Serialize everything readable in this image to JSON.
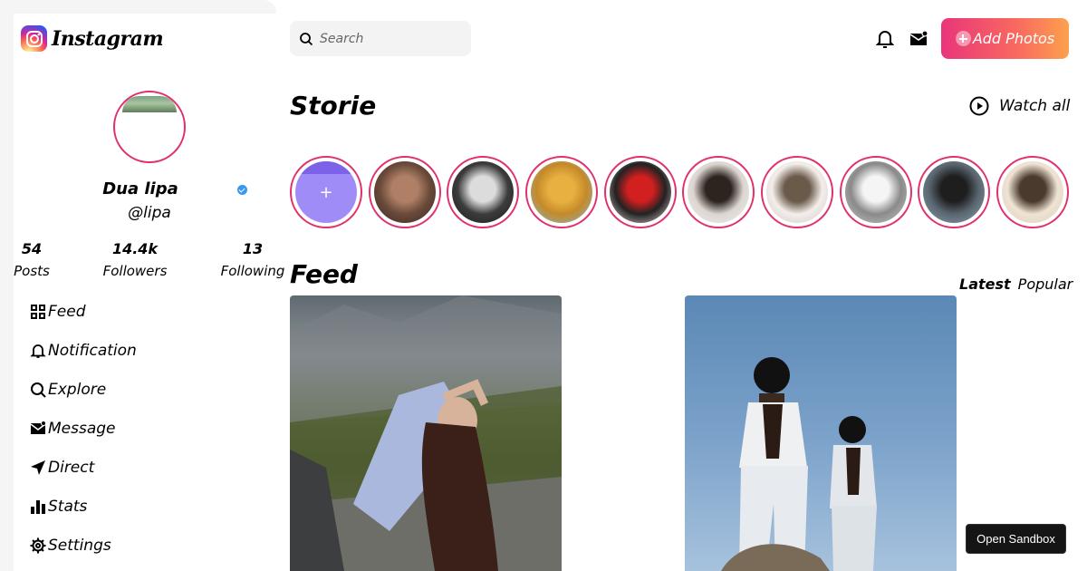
{
  "sidebar": {
    "logo_text": "Instagram",
    "profile": {
      "name": "Dua lipa",
      "handle": "@lipa",
      "verified": true
    },
    "stats": [
      {
        "value": "54",
        "label": "Posts"
      },
      {
        "value": "14.4k",
        "label": "Followers"
      },
      {
        "value": "13",
        "label": "Following"
      }
    ],
    "nav": [
      {
        "label": "Feed",
        "icon": "grid-icon"
      },
      {
        "label": "Notification",
        "icon": "bell-icon"
      },
      {
        "label": "Explore",
        "icon": "search-icon"
      },
      {
        "label": "Message",
        "icon": "mail-icon"
      },
      {
        "label": "Direct",
        "icon": "send-icon"
      },
      {
        "label": "Stats",
        "icon": "bar-chart-icon"
      },
      {
        "label": "Settings",
        "icon": "gear-icon"
      }
    ]
  },
  "header": {
    "search_placeholder": "Search",
    "add_photos_label": "Add Photos",
    "notification_icon": "bell-icon",
    "message_icon": "mail-icon"
  },
  "stories": {
    "title": "Storie",
    "watch_all_label": "Watch all",
    "add_label": "+",
    "items": [
      {
        "colors": [
          "#3a2a22",
          "#b08066",
          "#6a4a3a"
        ]
      },
      {
        "colors": [
          "#1b1b1b",
          "#dcdcdc",
          "#3c3c3c"
        ]
      },
      {
        "colors": [
          "#7fb8d8",
          "#e8b040",
          "#c48a2a"
        ]
      },
      {
        "colors": [
          "#f0dede",
          "#d21f1f",
          "#222222"
        ]
      },
      {
        "colors": [
          "#efefef",
          "#2d2420",
          "#dcd6d0"
        ]
      },
      {
        "colors": [
          "#cfc8bf",
          "#6a5a4a",
          "#f3eeea"
        ]
      },
      {
        "colors": [
          "#c8c8c8",
          "#f5f5f5",
          "#8a8a8a"
        ]
      },
      {
        "colors": [
          "#8da3b3",
          "#1e1e1e",
          "#5a6670"
        ]
      },
      {
        "colors": [
          "#d9ccb8",
          "#4a3a2e",
          "#efe4d4"
        ]
      }
    ]
  },
  "feed": {
    "title": "Feed",
    "tabs": [
      "Latest",
      "Popular"
    ],
    "active_tab": "Latest"
  },
  "sandbox_label": "Open Sandbox",
  "colors": {
    "accent_ring": "#e1306c",
    "button_gradient_start": "#e9357a",
    "button_gradient_end": "#fca14d",
    "verified": "#3897f0"
  }
}
